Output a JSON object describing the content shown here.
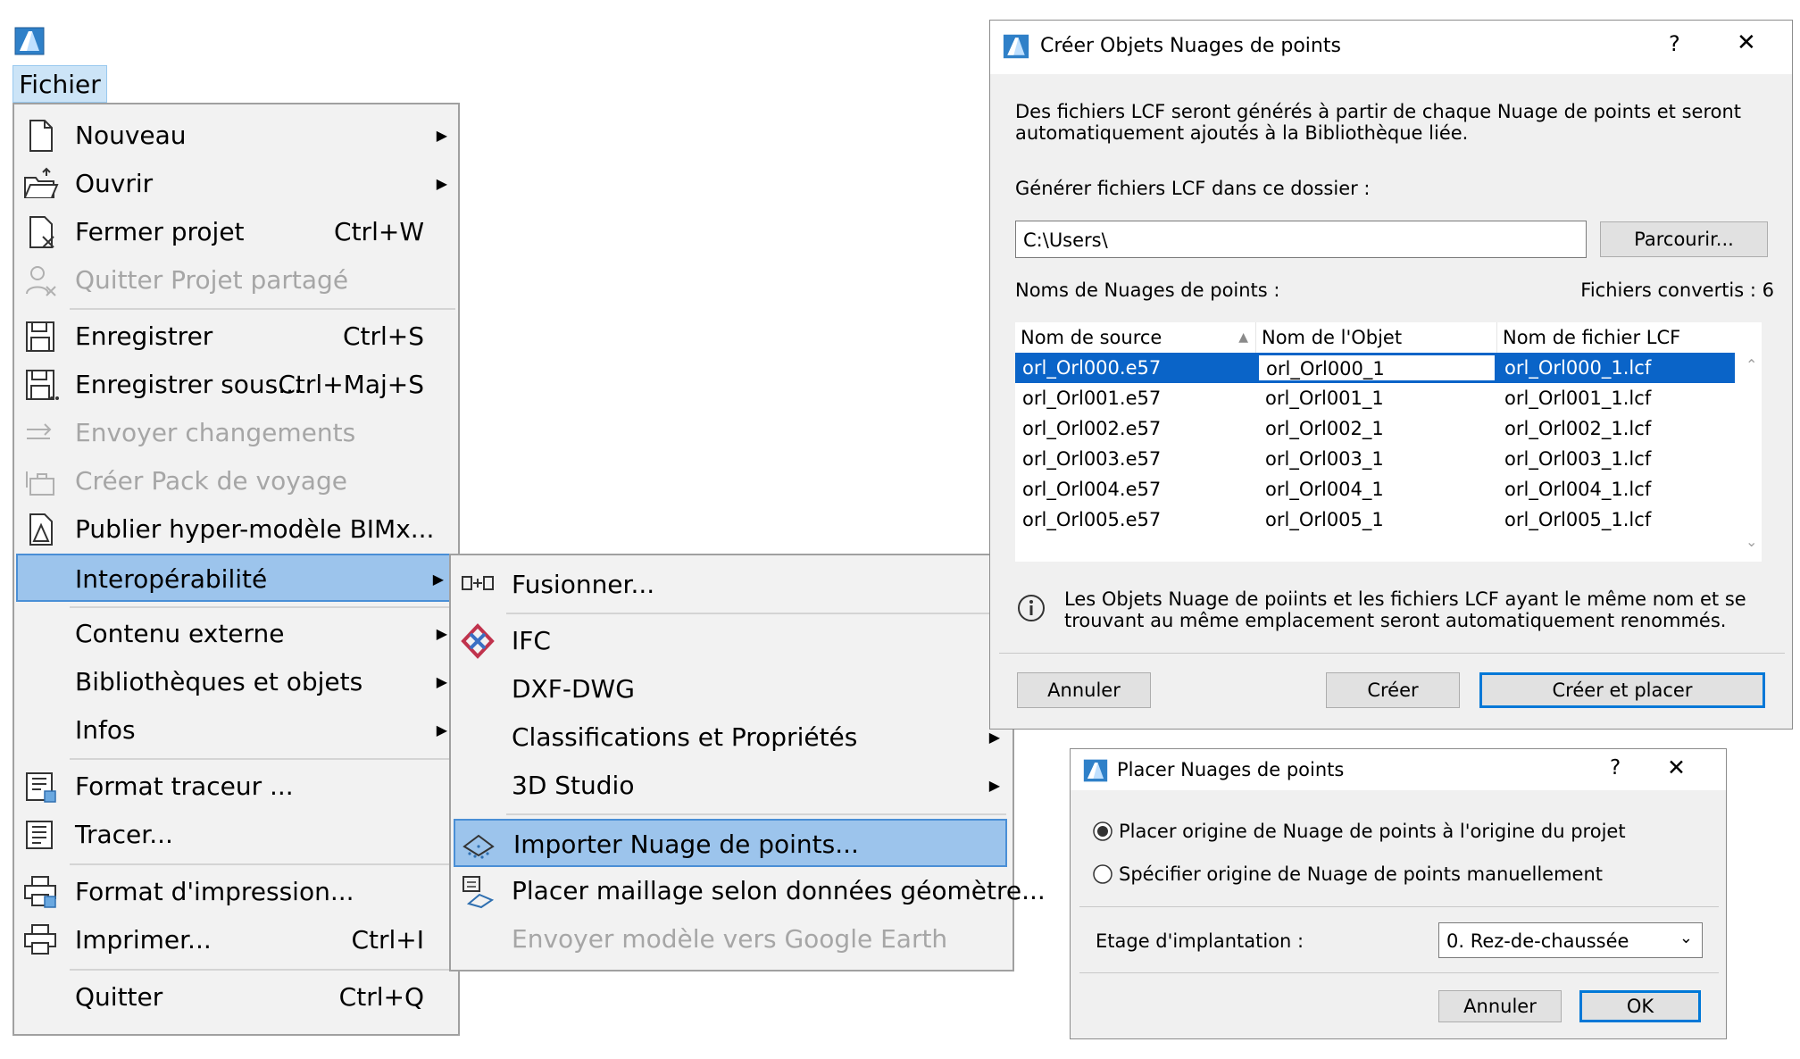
{
  "menubar": {
    "fichier": "Fichier"
  },
  "main_menu": {
    "items": [
      {
        "label": "Nouveau",
        "shortcut": "",
        "icon": "new-document-icon"
      },
      {
        "label": "Ouvrir",
        "shortcut": "",
        "icon": "open-folder-icon"
      },
      {
        "label": "Fermer projet",
        "shortcut": "Ctrl+W",
        "icon": "close-project-icon"
      },
      {
        "label": "Quitter Projet partagé",
        "shortcut": "",
        "icon": "leave-shared-icon"
      },
      {
        "label": "Enregistrer",
        "shortcut": "Ctrl+S",
        "icon": "save-icon"
      },
      {
        "label": "Enregistrer sous...",
        "shortcut": "Ctrl+Maj+S",
        "icon": "save-as-icon"
      },
      {
        "label": "Envoyer changements",
        "shortcut": "",
        "icon": "send-changes-icon"
      },
      {
        "label": "Créer Pack de voyage",
        "shortcut": "",
        "icon": "travel-pack-icon"
      },
      {
        "label": "Publier hyper-modèle BIMx...",
        "shortcut": "",
        "icon": "bimx-icon"
      },
      {
        "label": "Interopérabilité",
        "shortcut": "",
        "icon": ""
      },
      {
        "label": "Contenu externe",
        "shortcut": "",
        "icon": ""
      },
      {
        "label": "Bibliothèques et objets",
        "shortcut": "",
        "icon": ""
      },
      {
        "label": "Infos",
        "shortcut": "",
        "icon": ""
      },
      {
        "label": "Format traceur ...",
        "shortcut": "",
        "icon": "plotter-setup-icon"
      },
      {
        "label": "Tracer...",
        "shortcut": "",
        "icon": "plot-icon"
      },
      {
        "label": "Format d'impression...",
        "shortcut": "",
        "icon": "print-setup-icon"
      },
      {
        "label": "Imprimer...",
        "shortcut": "Ctrl+I",
        "icon": "print-icon"
      },
      {
        "label": "Quitter",
        "shortcut": "Ctrl+Q",
        "icon": ""
      }
    ]
  },
  "sub_menu": {
    "items": [
      {
        "label": "Fusionner...",
        "icon": "merge-icon"
      },
      {
        "label": "IFC",
        "icon": "ifc-icon"
      },
      {
        "label": "DXF-DWG",
        "icon": ""
      },
      {
        "label": "Classifications et Propriétés",
        "icon": ""
      },
      {
        "label": "3D Studio",
        "icon": ""
      },
      {
        "label": "Importer Nuage de points...",
        "icon": "point-cloud-icon"
      },
      {
        "label": "Placer maillage selon données géomètre...",
        "icon": "survey-mesh-icon"
      },
      {
        "label": "Envoyer modèle vers Google Earth",
        "icon": ""
      }
    ]
  },
  "create_dialog": {
    "title": "Créer Objets Nuages de points",
    "help": "?",
    "close": "✕",
    "description_line1": "Des fichiers LCF seront générés à partir de chaque Nuage de points et seront",
    "description_line2": "automatiquement ajoutés à la Bibliothèque liée.",
    "folder_label": "Générer fichiers LCF dans ce dossier :",
    "folder_value": "C:\\Users\\",
    "browse_button": "Parcourir...",
    "list_label": "Noms de Nuages de points :",
    "converted_label": "Fichiers convertis : 6",
    "columns": [
      "Nom de source",
      "Nom de l'Objet",
      "Nom de fichier LCF"
    ],
    "rows": [
      [
        "orl_Orl000.e57",
        "orl_Orl000_1",
        "orl_Orl000_1.lcf"
      ],
      [
        "orl_Orl001.e57",
        "orl_Orl001_1",
        "orl_Orl001_1.lcf"
      ],
      [
        "orl_Orl002.e57",
        "orl_Orl002_1",
        "orl_Orl002_1.lcf"
      ],
      [
        "orl_Orl003.e57",
        "orl_Orl003_1",
        "orl_Orl003_1.lcf"
      ],
      [
        "orl_Orl004.e57",
        "orl_Orl004_1",
        "orl_Orl004_1.lcf"
      ],
      [
        "orl_Orl005.e57",
        "orl_Orl005_1",
        "orl_Orl005_1.lcf"
      ]
    ],
    "info_line1": "Les Objets Nuage de poiints et les fichiers LCF ayant le même nom et se",
    "info_line2": "trouvant au même emplacement seront automatiquement renommés.",
    "cancel": "Annuler",
    "create": "Créer",
    "create_place": "Créer et placer"
  },
  "place_dialog": {
    "title": "Placer Nuages de points",
    "help": "?",
    "close": "✕",
    "option1": "Placer origine de Nuage de points à l'origine du projet",
    "option2": "Spécifier origine de Nuage de points manuellement",
    "selected_option": 1,
    "story_label": "Etage d'implantation :",
    "story_value": "0. Rez-de-chaussée",
    "cancel": "Annuler",
    "ok": "OK"
  },
  "colors": {
    "menu_highlight": "#9cc4ec",
    "row_selected": "#0a64c8",
    "default_button_border": "#0078d7"
  }
}
